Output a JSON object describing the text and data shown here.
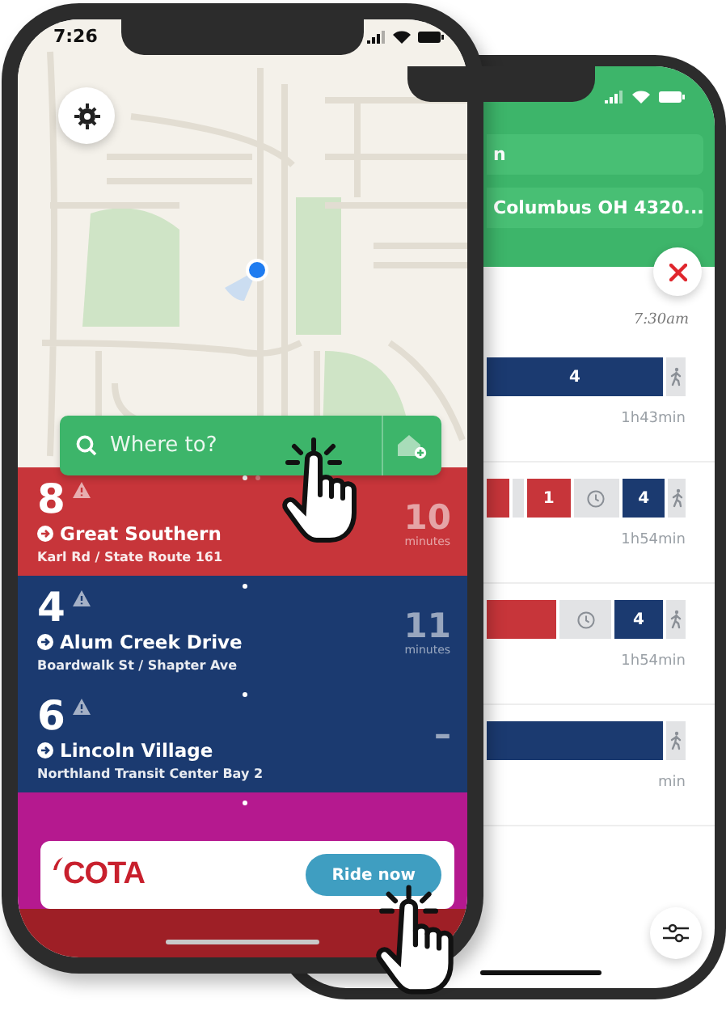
{
  "front_phone": {
    "status_bar": {
      "time": "7:26"
    },
    "search": {
      "placeholder": "Where to?"
    },
    "routes": [
      {
        "number": "8",
        "name": "Great Southern",
        "stop": "Karl Rd / State Route 161",
        "eta": "10",
        "eta_unit": "minutes",
        "color": "#c7353a",
        "alert": true,
        "pages": [
          {
            "selected": true
          },
          {
            "selected": false
          }
        ]
      },
      {
        "number": "4",
        "name": "Alum Creek Drive",
        "stop": "Boardwalk St / Shapter Ave",
        "eta": "11",
        "eta_unit": "minutes",
        "color": "#1b3a70",
        "alert": true,
        "pages": [
          {
            "selected": true
          }
        ]
      },
      {
        "number": "6",
        "name": "Lincoln Village",
        "stop": "Northland Transit Center Bay 2",
        "eta": "–",
        "color": "#1b3a70",
        "alert": true,
        "pages": [
          {
            "selected": true
          }
        ]
      },
      {
        "color": "#b5198f",
        "alert": false,
        "pages": [
          {
            "selected": true
          }
        ]
      }
    ],
    "banner": {
      "brand": "COTA",
      "button": "Ride now"
    }
  },
  "back_phone": {
    "origin": "n",
    "destination": "Columbus OH 4320...",
    "departure_time": "7:30am",
    "trips": [
      {
        "duration": "1h43min",
        "segments": [
          {
            "kind": "bus",
            "label": "4",
            "color": "#1b3a70"
          },
          {
            "kind": "walk"
          }
        ]
      },
      {
        "duration": "1h54min",
        "segments": [
          {
            "kind": "bus",
            "color": "#c7353a"
          },
          {
            "kind": "transfer"
          },
          {
            "kind": "bus",
            "label": "1",
            "color": "#c7353a"
          },
          {
            "kind": "wait"
          },
          {
            "kind": "bus",
            "label": "4",
            "color": "#1b3a70"
          },
          {
            "kind": "walk"
          }
        ]
      },
      {
        "duration": "1h54min",
        "segments": [
          {
            "kind": "bus",
            "color": "#c7353a"
          },
          {
            "kind": "wait"
          },
          {
            "kind": "bus",
            "label": "4",
            "color": "#1b3a70"
          },
          {
            "kind": "walk"
          }
        ]
      },
      {
        "duration": "min",
        "segments": [
          {
            "kind": "bus",
            "color": "#1b3a70"
          },
          {
            "kind": "walk"
          }
        ]
      }
    ]
  }
}
